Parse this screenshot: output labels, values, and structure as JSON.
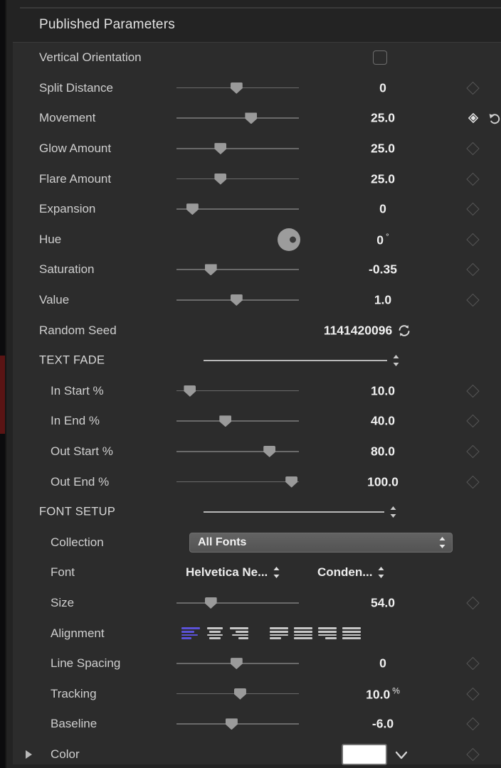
{
  "panel": {
    "title": "Published Parameters",
    "accent_active": "#5b52d8",
    "background": "#2c2c2c"
  },
  "rows": [
    {
      "label": "Vertical Orientation",
      "type": "checkbox",
      "checked": false
    },
    {
      "label": "Split Distance",
      "type": "slider",
      "value": "0",
      "slider_pct": 49,
      "keyframe": "idle"
    },
    {
      "label": "Movement",
      "type": "slider",
      "value": "25.0",
      "slider_pct": 61,
      "keyframe": "active",
      "reset": true
    },
    {
      "label": "Glow Amount",
      "type": "slider",
      "value": "25.0",
      "slider_pct": 36,
      "keyframe": "idle"
    },
    {
      "label": "Flare Amount",
      "type": "slider",
      "value": "25.0",
      "slider_pct": 36,
      "keyframe": "idle"
    },
    {
      "label": "Expansion",
      "type": "slider",
      "value": "0",
      "slider_pct": 13,
      "keyframe": "idle"
    },
    {
      "label": "Hue",
      "type": "wheel",
      "value": "0",
      "unit": "°",
      "keyframe": "idle"
    },
    {
      "label": "Saturation",
      "type": "slider",
      "value": "-0.35",
      "slider_pct": 28,
      "keyframe": "idle"
    },
    {
      "label": "Value",
      "type": "slider",
      "value": "1.0",
      "slider_pct": 49,
      "keyframe": "idle"
    },
    {
      "label": "Random Seed",
      "type": "seed",
      "value": "1141420096",
      "icon": "refresh-icon"
    },
    {
      "label": "TEXT FADE",
      "type": "section"
    },
    {
      "label": "In Start %",
      "type": "slider",
      "value": "10.0",
      "slider_pct": 11,
      "indent": true,
      "keyframe": "idle"
    },
    {
      "label": "In End %",
      "type": "slider",
      "value": "40.0",
      "slider_pct": 40,
      "indent": true,
      "keyframe": "idle"
    },
    {
      "label": "Out Start %",
      "type": "slider",
      "value": "80.0",
      "slider_pct": 76,
      "indent": true,
      "keyframe": "idle"
    },
    {
      "label": "Out End %",
      "type": "slider",
      "value": "100.0",
      "slider_pct": 94,
      "indent": true,
      "keyframe": "idle"
    },
    {
      "label": "FONT SETUP",
      "type": "section"
    },
    {
      "label": "Collection",
      "type": "popup",
      "value": "All Fonts",
      "indent": true
    },
    {
      "label": "Font",
      "type": "fontmenus",
      "font_family": "Helvetica Ne...",
      "font_style": "Conden...",
      "indent": true
    },
    {
      "label": "Size",
      "type": "slider",
      "value": "54.0",
      "slider_pct": 28,
      "indent": true,
      "keyframe": "idle"
    },
    {
      "label": "Alignment",
      "type": "alignment",
      "indent": true,
      "selected_index": 0
    },
    {
      "label": "Line Spacing",
      "type": "slider",
      "value": "0",
      "slider_pct": 49,
      "indent": true,
      "keyframe": "idle"
    },
    {
      "label": "Tracking",
      "type": "slider",
      "value": "10.0",
      "unit": "%",
      "slider_pct": 52,
      "indent": true,
      "keyframe": "idle"
    },
    {
      "label": "Baseline",
      "type": "slider",
      "value": "-6.0",
      "slider_pct": 45,
      "indent": true,
      "keyframe": "idle"
    },
    {
      "label": "Color",
      "type": "color",
      "swatch": "#ffffff",
      "indent": true,
      "disclosure": true,
      "keyframe": "idle"
    }
  ],
  "alignment_icons": [
    "align-left-icon",
    "align-center-icon",
    "align-right-icon",
    "align-top-left-icon",
    "align-top-center-icon",
    "align-top-right-icon",
    "align-justify-icon"
  ]
}
